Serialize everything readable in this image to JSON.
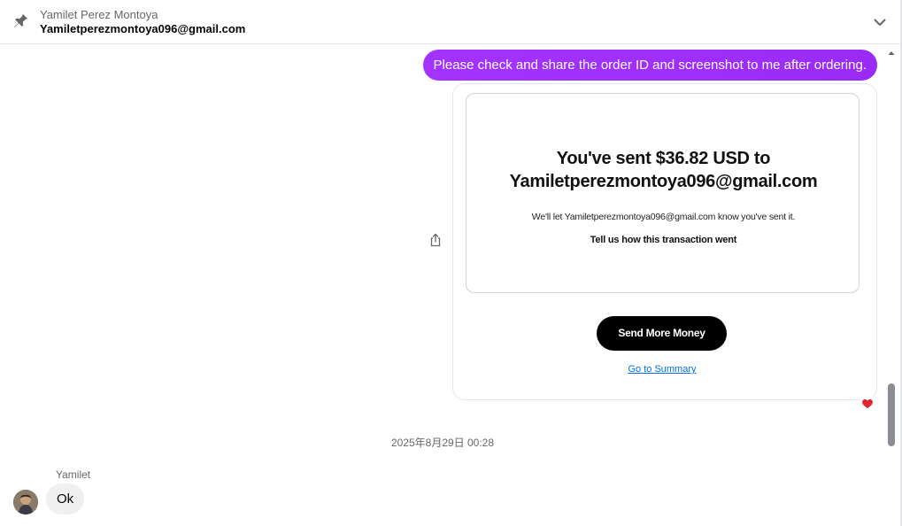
{
  "header": {
    "contact_name": "Yamilet Perez Montoya",
    "contact_email": "Yamiletperezmontoya096@gmail.com",
    "pin_icon": "pin-icon",
    "expand_icon": "chevron-down-icon"
  },
  "messages": {
    "outgoing_text": "Please check and share the order ID and screenshot to me after ordering.",
    "outgoing_color": "#a033ff",
    "attachment": {
      "title_line1": "You've sent $36.82 USD to",
      "title_line2": "Yamiletperezmontoya096@gmail.com",
      "note": "We'll let Yamiletperezmontoya096@gmail.com know you've sent it.",
      "tell": "Tell us how this transaction went",
      "send_more": "Send More Money",
      "go_summary": "Go to Summary"
    },
    "reaction": "heart-icon",
    "timestamp": "2025年8月29日 00:28",
    "sender_name": "Yamilet",
    "incoming_text": "Ok"
  }
}
